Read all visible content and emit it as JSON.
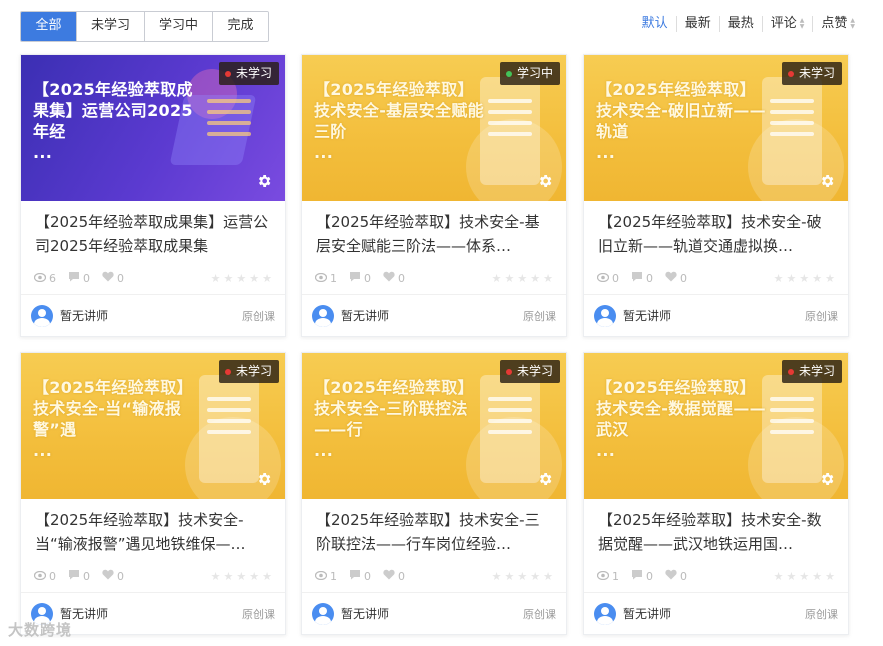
{
  "filters": [
    "全部",
    "未学习",
    "学习中",
    "完成"
  ],
  "active_filter": 0,
  "sort": [
    {
      "label": "默认",
      "active": true,
      "arrows": false
    },
    {
      "label": "最新",
      "active": false,
      "arrows": false
    },
    {
      "label": "最热",
      "active": false,
      "arrows": false
    },
    {
      "label": "评论",
      "active": false,
      "arrows": true
    },
    {
      "label": "点赞",
      "active": false,
      "arrows": true
    }
  ],
  "cards": [
    {
      "theme": "purple",
      "thumb_title": "【2025年经验萃取成果集】运营公司2025年经",
      "status": "未学习",
      "status_color": "#e53935",
      "title": "【2025年经验萃取成果集】运营公司2025年经验萃取成果集",
      "views": "6",
      "comments": "0",
      "likes": "0",
      "lecturer": "暂无讲师",
      "type": "原创课"
    },
    {
      "theme": "yellow",
      "thumb_title": "【2025年经验萃取】技术安全-基层安全赋能三阶",
      "status": "学习中",
      "status_color": "#43c35a",
      "title": "【2025年经验萃取】技术安全-基层安全赋能三阶法——体系…",
      "views": "1",
      "comments": "0",
      "likes": "0",
      "lecturer": "暂无讲师",
      "type": "原创课"
    },
    {
      "theme": "yellow",
      "thumb_title": "【2025年经验萃取】技术安全-破旧立新——轨道",
      "status": "未学习",
      "status_color": "#e53935",
      "title": "【2025年经验萃取】技术安全-破旧立新——轨道交通虚拟换…",
      "views": "0",
      "comments": "0",
      "likes": "0",
      "lecturer": "暂无讲师",
      "type": "原创课"
    },
    {
      "theme": "yellow",
      "thumb_title": "【2025年经验萃取】技术安全-当“输液报警”遇",
      "status": "未学习",
      "status_color": "#e53935",
      "title": "【2025年经验萃取】技术安全-当“输液报警”遇见地铁维保—…",
      "views": "0",
      "comments": "0",
      "likes": "0",
      "lecturer": "暂无讲师",
      "type": "原创课"
    },
    {
      "theme": "yellow",
      "thumb_title": "【2025年经验萃取】技术安全-三阶联控法——行",
      "status": "未学习",
      "status_color": "#e53935",
      "title": "【2025年经验萃取】技术安全-三阶联控法——行车岗位经验…",
      "views": "1",
      "comments": "0",
      "likes": "0",
      "lecturer": "暂无讲师",
      "type": "原创课"
    },
    {
      "theme": "yellow",
      "thumb_title": "【2025年经验萃取】技术安全-数据觉醒——武汉",
      "status": "未学习",
      "status_color": "#e53935",
      "title": "【2025年经验萃取】技术安全-数据觉醒——武汉地铁运用国…",
      "views": "1",
      "comments": "0",
      "likes": "0",
      "lecturer": "暂无讲师",
      "type": "原创课"
    }
  ],
  "thumb_ellipsis": "...",
  "watermark": "大数跨境",
  "colors": {
    "accent": "#3d7be0"
  }
}
